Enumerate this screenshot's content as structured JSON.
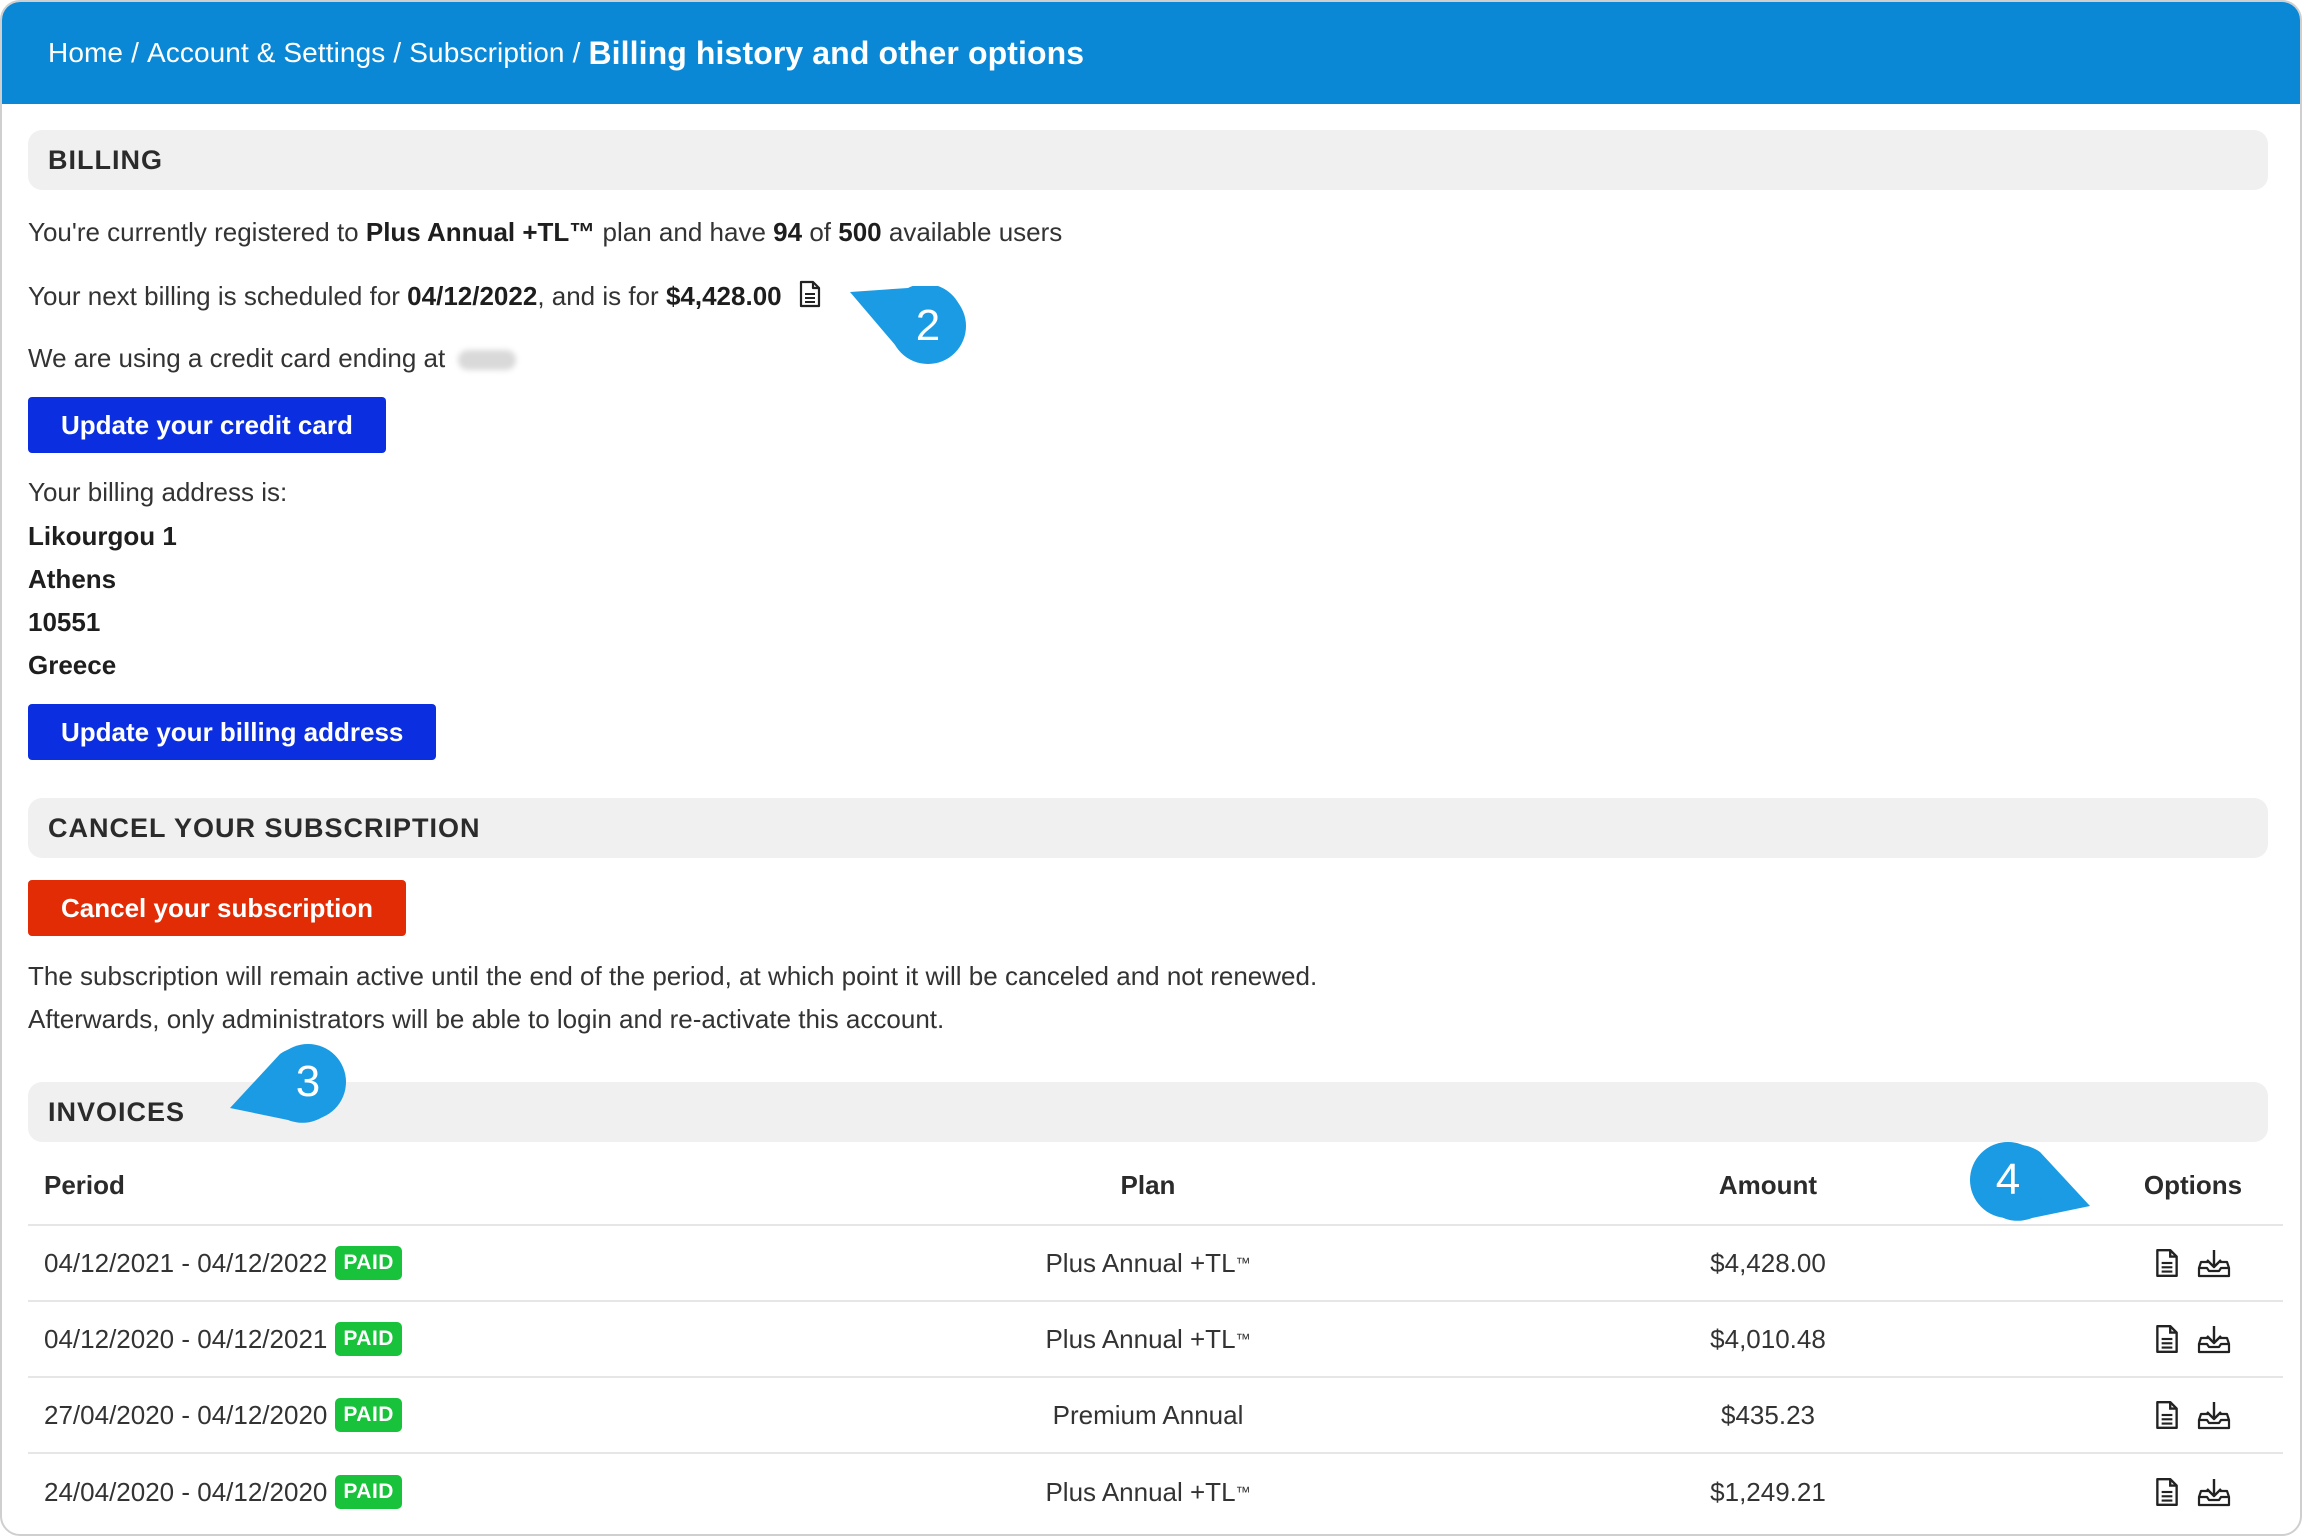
{
  "breadcrumb": {
    "items": [
      "Home",
      "Account & Settings",
      "Subscription"
    ],
    "separator": "/",
    "current": "Billing history and other options"
  },
  "billing": {
    "title": "BILLING",
    "plan_prefix": "You're currently registered to",
    "plan_name": "Plus Annual +TL™",
    "plan_mid": "plan and have",
    "users_used": "94",
    "users_of": "of",
    "users_total": "500",
    "users_suffix": "available users",
    "next_prefix": "Your next billing is scheduled for",
    "next_date": "04/12/2022",
    "next_mid": ", and is for",
    "next_amount": "$4,428.00",
    "card_text": "We are using a credit card ending at",
    "update_card_label": "Update your credit card",
    "address_label": "Your billing address is:",
    "address_lines": [
      "Likourgou 1",
      "Athens",
      "10551",
      "Greece"
    ],
    "update_address_label": "Update your billing address"
  },
  "cancel": {
    "title": "CANCEL YOUR SUBSCRIPTION",
    "button_label": "Cancel your subscription",
    "note_line1": "The subscription will remain active until the end of the period, at which point it will be canceled and not renewed.",
    "note_line2": "Afterwards, only administrators will be able to login and re-activate this account."
  },
  "invoices": {
    "title": "INVOICES",
    "columns": {
      "period": "Period",
      "plan": "Plan",
      "amount": "Amount",
      "options": "Options"
    },
    "rows": [
      {
        "period": "04/12/2021 - 04/12/2022",
        "status": "PAID",
        "plan": "Plus Annual +TL",
        "tm": "™",
        "amount": "$4,428.00"
      },
      {
        "period": "04/12/2020 - 04/12/2021",
        "status": "PAID",
        "plan": "Plus Annual +TL",
        "tm": "™",
        "amount": "$4,010.48"
      },
      {
        "period": "27/04/2020 - 04/12/2020",
        "status": "PAID",
        "plan": "Premium Annual",
        "tm": "",
        "amount": "$435.23"
      },
      {
        "period": "24/04/2020 - 04/12/2020",
        "status": "PAID",
        "plan": "Plus Annual +TL",
        "tm": "™",
        "amount": "$1,249.21"
      }
    ]
  },
  "callouts": [
    "2",
    "3",
    "4"
  ],
  "icons": {
    "invoice": "document-icon",
    "download": "download-icon"
  },
  "colors": {
    "header": "#0a88d6",
    "primary_button": "#0b2fe0",
    "danger_button": "#e22c05",
    "paid_badge": "#18c23a",
    "callout": "#1a9be3"
  }
}
